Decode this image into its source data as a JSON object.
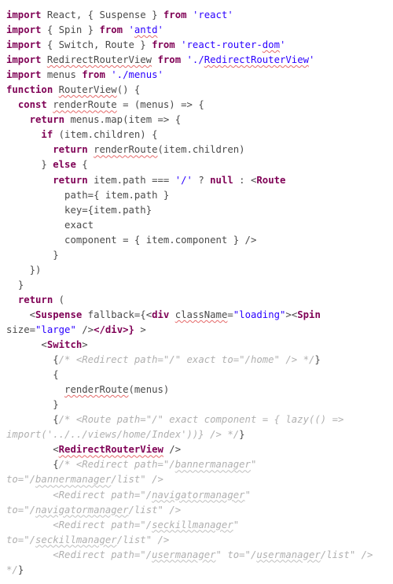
{
  "chart_data": null,
  "code": {
    "lines": [
      {
        "indent": 0,
        "segments": [
          {
            "t": "import ",
            "cls": "kw"
          },
          {
            "t": "React, { Suspense } "
          },
          {
            "t": "from ",
            "cls": "kw"
          },
          {
            "t": "'react'",
            "cls": "str"
          }
        ]
      },
      {
        "indent": 0,
        "segments": [
          {
            "t": "import ",
            "cls": "kw"
          },
          {
            "t": "{ Spin } "
          },
          {
            "t": "from ",
            "cls": "kw"
          },
          {
            "t": "'",
            "cls": "str"
          },
          {
            "t": "antd",
            "cls": "str sq"
          },
          {
            "t": "'",
            "cls": "str"
          }
        ]
      },
      {
        "indent": 0,
        "segments": [
          {
            "t": "import ",
            "cls": "kw"
          },
          {
            "t": "{ Switch, Route } "
          },
          {
            "t": "from ",
            "cls": "kw"
          },
          {
            "t": "'react-router-",
            "cls": "str"
          },
          {
            "t": "dom",
            "cls": "str sq"
          },
          {
            "t": "'",
            "cls": "str"
          }
        ]
      },
      {
        "indent": 0,
        "segments": [
          {
            "t": "import ",
            "cls": "kw"
          },
          {
            "t": "RedirectRouterView",
            "cls": "sq"
          },
          {
            "t": " "
          },
          {
            "t": "from ",
            "cls": "kw"
          },
          {
            "t": "'./",
            "cls": "str"
          },
          {
            "t": "RedirectRouterView",
            "cls": "str sq"
          },
          {
            "t": "'",
            "cls": "str"
          }
        ]
      },
      {
        "indent": 0,
        "segments": [
          {
            "t": "import ",
            "cls": "kw"
          },
          {
            "t": "menus "
          },
          {
            "t": "from ",
            "cls": "kw"
          },
          {
            "t": "'./menus'",
            "cls": "str"
          }
        ]
      },
      {
        "indent": 0,
        "segments": [
          {
            "t": "function ",
            "cls": "kw"
          },
          {
            "t": "RouterView",
            "cls": "sq"
          },
          {
            "t": "() {"
          }
        ]
      },
      {
        "indent": 1,
        "segments": [
          {
            "t": "const ",
            "cls": "kw"
          },
          {
            "t": "renderRoute",
            "cls": "sq"
          },
          {
            "t": " = (menus) => {"
          }
        ]
      },
      {
        "indent": 2,
        "segments": [
          {
            "t": "return ",
            "cls": "kw"
          },
          {
            "t": "menus.map(item => {"
          }
        ]
      },
      {
        "indent": 3,
        "segments": [
          {
            "t": "if ",
            "cls": "kw"
          },
          {
            "t": "(item.children) {"
          }
        ]
      },
      {
        "indent": 4,
        "segments": [
          {
            "t": "return ",
            "cls": "kw"
          },
          {
            "t": "renderRoute",
            "cls": "sq"
          },
          {
            "t": "(item.children)"
          }
        ]
      },
      {
        "indent": 3,
        "segments": [
          {
            "t": "} "
          },
          {
            "t": "else ",
            "cls": "kw"
          },
          {
            "t": "{"
          }
        ]
      },
      {
        "indent": 4,
        "segments": [
          {
            "t": "return ",
            "cls": "kw"
          },
          {
            "t": "item.path === "
          },
          {
            "t": "'/'",
            "cls": "str"
          },
          {
            "t": " ? "
          },
          {
            "t": "null",
            "cls": "kw"
          },
          {
            "t": " : <"
          },
          {
            "t": "Route",
            "cls": "tag"
          }
        ]
      },
      {
        "indent": 5,
        "segments": [
          {
            "t": "path={ item.path }"
          }
        ]
      },
      {
        "indent": 5,
        "segments": [
          {
            "t": "key={item.path}"
          }
        ]
      },
      {
        "indent": 5,
        "segments": [
          {
            "t": "exact"
          }
        ]
      },
      {
        "indent": 5,
        "segments": [
          {
            "t": "component = { item.component } />"
          }
        ]
      },
      {
        "indent": 4,
        "segments": [
          {
            "t": "}"
          }
        ]
      },
      {
        "indent": 2,
        "segments": [
          {
            "t": "})"
          }
        ]
      },
      {
        "indent": 1,
        "segments": [
          {
            "t": "}"
          }
        ]
      },
      {
        "indent": 1,
        "segments": [
          {
            "t": "return ",
            "cls": "kw"
          },
          {
            "t": "("
          }
        ]
      },
      {
        "indent": 2,
        "segments": [
          {
            "t": "<"
          },
          {
            "t": "Suspense",
            "cls": "tag"
          },
          {
            "t": " fallback={<"
          },
          {
            "t": "div",
            "cls": "tag"
          },
          {
            "t": " "
          },
          {
            "t": "className",
            "cls": "sq"
          },
          {
            "t": "="
          },
          {
            "t": "\"loading\"",
            "cls": "str"
          },
          {
            "t": "><"
          },
          {
            "t": "Spin",
            "cls": "tag"
          },
          {
            "t": " size="
          },
          {
            "t": "\"large\"",
            "cls": "str"
          },
          {
            "t": " />"
          },
          {
            "t": "</",
            "cls": "tag"
          },
          {
            "t": "div",
            "cls": "tag"
          },
          {
            "t": ">} ",
            "cls": "tag"
          },
          {
            "t": ">"
          }
        ]
      },
      {
        "indent": 3,
        "segments": [
          {
            "t": "<"
          },
          {
            "t": "Switch",
            "cls": "tag"
          },
          {
            "t": ">"
          }
        ]
      },
      {
        "indent": 4,
        "segments": [
          {
            "t": "{"
          },
          {
            "t": "/* <Redirect path=\"/\" exact to=\"/home\" /> */",
            "cls": "cmt"
          },
          {
            "t": "}"
          }
        ]
      },
      {
        "indent": 4,
        "segments": [
          {
            "t": "{"
          }
        ]
      },
      {
        "indent": 5,
        "segments": [
          {
            "t": "renderRoute",
            "cls": "sq"
          },
          {
            "t": "(menus)"
          }
        ]
      },
      {
        "indent": 4,
        "segments": [
          {
            "t": "}"
          }
        ]
      },
      {
        "indent": 4,
        "segments": [
          {
            "t": "{"
          },
          {
            "t": "/* <Route path=\"/\" exact component = { lazy(() => import('../../views/home/Index'))} /> */",
            "cls": "cmt"
          },
          {
            "t": "}"
          }
        ]
      },
      {
        "indent": 4,
        "segments": [
          {
            "t": "<"
          },
          {
            "t": "RedirectRouterView",
            "cls": "tag sq"
          },
          {
            "t": " />"
          }
        ]
      },
      {
        "indent": 4,
        "segments": [
          {
            "t": "{"
          },
          {
            "t": "/* <Redirect path=\"/",
            "cls": "cmt"
          },
          {
            "t": "bannermanager",
            "cls": "cmt sqc"
          },
          {
            "t": "\" to=\"/",
            "cls": "cmt"
          },
          {
            "t": "bannermanager",
            "cls": "cmt sqc"
          },
          {
            "t": "/list\" />",
            "cls": "cmt"
          }
        ]
      },
      {
        "indent": 4,
        "segments": [
          {
            "t": "<Redirect path=\"/",
            "cls": "cmt"
          },
          {
            "t": "navigatormanager",
            "cls": "cmt sqc"
          },
          {
            "t": "\" to=\"/",
            "cls": "cmt"
          },
          {
            "t": "navigatormanager",
            "cls": "cmt sqc"
          },
          {
            "t": "/list\" />",
            "cls": "cmt"
          }
        ]
      },
      {
        "indent": 4,
        "segments": [
          {
            "t": "<Redirect path=\"/",
            "cls": "cmt"
          },
          {
            "t": "seckillmanager",
            "cls": "cmt sqc"
          },
          {
            "t": "\" to=\"/",
            "cls": "cmt"
          },
          {
            "t": "seckillmanager",
            "cls": "cmt sqc"
          },
          {
            "t": "/list\" />",
            "cls": "cmt"
          }
        ]
      },
      {
        "indent": 4,
        "segments": [
          {
            "t": "<Redirect path=\"/",
            "cls": "cmt"
          },
          {
            "t": "usermanager",
            "cls": "cmt sqc"
          },
          {
            "t": "\" to=\"/",
            "cls": "cmt"
          },
          {
            "t": "usermanager",
            "cls": "cmt sqc"
          },
          {
            "t": "/list\" /> */",
            "cls": "cmt"
          },
          {
            "t": "}"
          }
        ]
      }
    ]
  }
}
